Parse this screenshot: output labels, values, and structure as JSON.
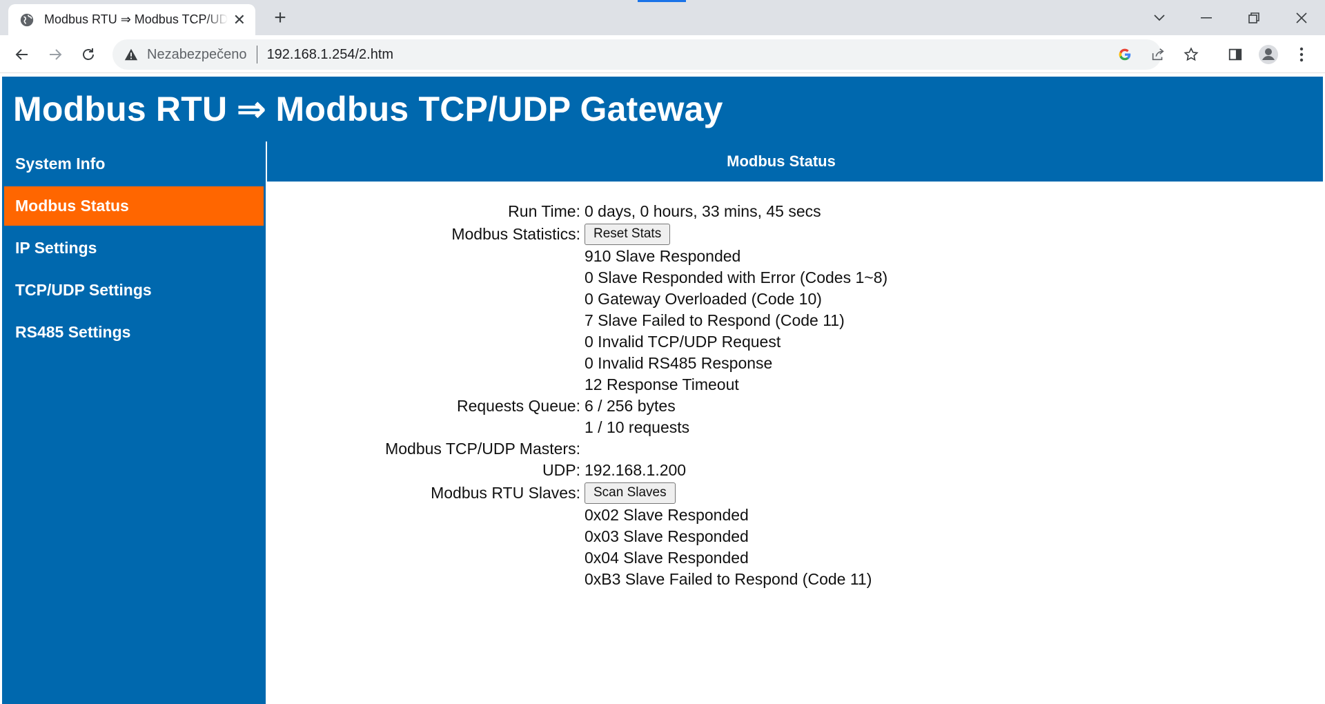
{
  "browser": {
    "tab_title": "Modbus RTU ⇒ Modbus TCP/UDP Gateway",
    "security_label": "Nezabezpečeno",
    "url": "192.168.1.254/2.htm",
    "colors": {
      "tabbar_bg": "#dee1e6",
      "omnibox_bg": "#f1f3f4"
    }
  },
  "header": {
    "title": "Modbus RTU ⇒ Modbus TCP/UDP Gateway"
  },
  "sidebar": {
    "items": [
      {
        "label": "System Info",
        "active": false
      },
      {
        "label": "Modbus Status",
        "active": true
      },
      {
        "label": "IP Settings",
        "active": false
      },
      {
        "label": "TCP/UDP Settings",
        "active": false
      },
      {
        "label": "RS485 Settings",
        "active": false
      }
    ]
  },
  "content": {
    "section_title": "Modbus Status",
    "run_time": {
      "label": "Run Time:",
      "value": "0 days, 0 hours, 33 mins, 45 secs"
    },
    "statistics": {
      "label": "Modbus Statistics:",
      "reset_button": "Reset Stats",
      "lines": [
        "910 Slave Responded",
        "0 Slave Responded with Error (Codes 1~8)",
        "0 Gateway Overloaded (Code 10)",
        "7 Slave Failed to Respond (Code 11)",
        "0 Invalid TCP/UDP Request",
        "0 Invalid RS485 Response",
        "12 Response Timeout"
      ]
    },
    "requests_queue": {
      "label": "Requests Queue:",
      "bytes": "6 / 256 bytes",
      "requests": "1 / 10 requests"
    },
    "masters": {
      "label": "Modbus TCP/UDP Masters:",
      "udp_label": "UDP:",
      "udp_value": "192.168.1.200"
    },
    "slaves": {
      "label": "Modbus RTU Slaves:",
      "scan_button": "Scan Slaves",
      "lines": [
        "0x02 Slave Responded",
        "0x03 Slave Responded",
        "0x04 Slave Responded",
        "0xB3 Slave Failed to Respond (Code 11)"
      ]
    }
  },
  "colors": {
    "primary": "#0068ae",
    "active": "#ff6600",
    "text": "#111111"
  }
}
